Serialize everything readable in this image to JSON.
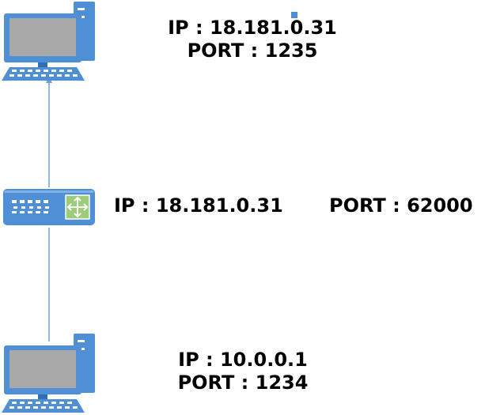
{
  "top_host": {
    "ip": "IP : 18.181.0.31",
    "port": "PORT : 1235",
    "icon": "desktop-computer-icon"
  },
  "router": {
    "ip": "IP : 18.181.0.31",
    "port": "PORT : 62000",
    "icon": "router-icon"
  },
  "bottom_host": {
    "ip": "IP : 10.0.0.1",
    "port": "PORT : 1234",
    "icon": "desktop-computer-icon"
  },
  "colors": {
    "icon_blue": "#4f8fd6",
    "icon_dark": "#2f6fb4",
    "screen_gray": "#a8a8a8",
    "link_line": "#6d9fd8",
    "router_green": "#9ccb7a"
  }
}
